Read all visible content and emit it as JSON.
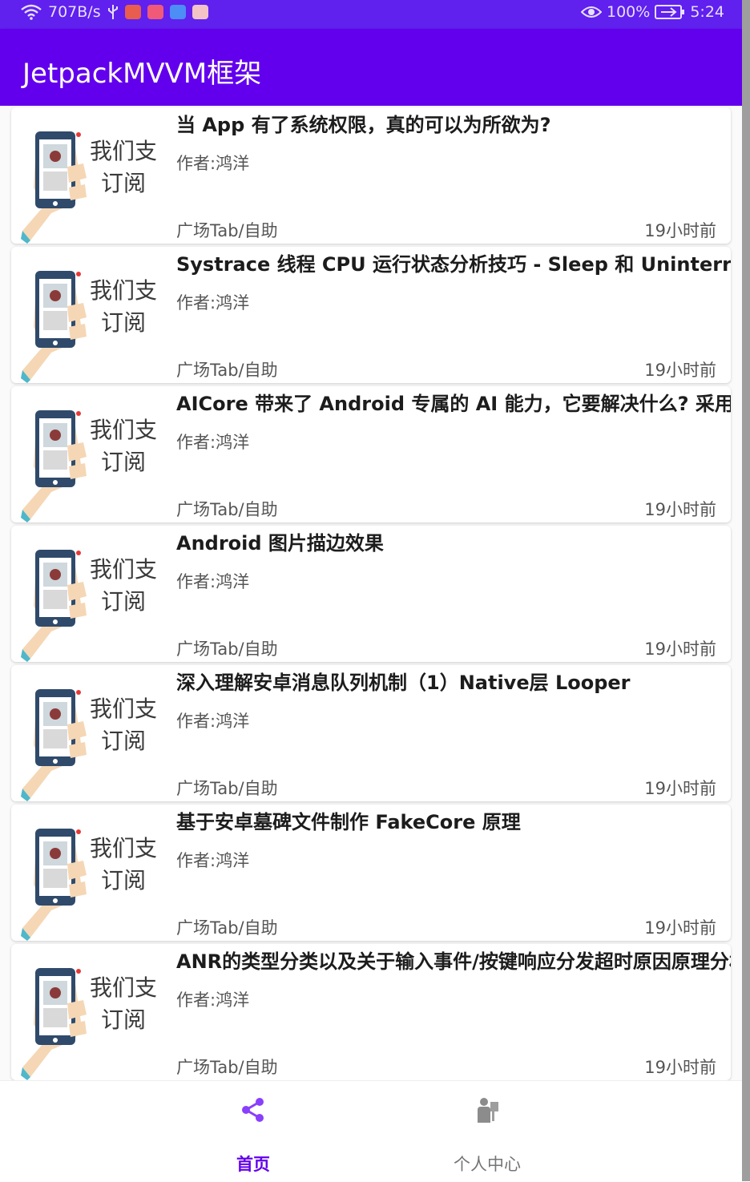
{
  "status_bar": {
    "network_speed": "707B/s",
    "battery": "100%",
    "time": "5:24"
  },
  "app_bar": {
    "title": "JetpackMVVM框架"
  },
  "articles": [
    {
      "title": "当 App 有了系统权限，真的可以为所欲为?",
      "author": "作者:鸿洋",
      "chapter": "广场Tab/自助",
      "time": "19小时前",
      "thumb_text": [
        "我们支",
        "订阅"
      ]
    },
    {
      "title": "Systrace 线程 CPU 运行状态分析技巧 - Sleep 和 Uninterruptible",
      "author": "作者:鸿洋",
      "chapter": "广场Tab/自助",
      "time": "19小时前",
      "thumb_text": [
        "我们支",
        "订阅"
      ]
    },
    {
      "title": "AICore 带来了 Android 专属的 AI 能力，它要解决什么? 采用什么",
      "author": "作者:鸿洋",
      "chapter": "广场Tab/自助",
      "time": "19小时前",
      "thumb_text": [
        "我们支",
        "订阅"
      ]
    },
    {
      "title": "Android 图片描边效果",
      "author": "作者:鸿洋",
      "chapter": "广场Tab/自助",
      "time": "19小时前",
      "thumb_text": [
        "我们支",
        "订阅"
      ]
    },
    {
      "title": "深入理解安卓消息队列机制（1）Native层 Looper",
      "author": "作者:鸿洋",
      "chapter": "广场Tab/自助",
      "time": "19小时前",
      "thumb_text": [
        "我们支",
        "订阅"
      ]
    },
    {
      "title": "基于安卓墓碑文件制作 FakeCore 原理",
      "author": "作者:鸿洋",
      "chapter": "广场Tab/自助",
      "time": "19小时前",
      "thumb_text": [
        "我们支",
        "订阅"
      ]
    },
    {
      "title": "ANR的类型分类以及关于输入事件/按键响应分发超时原因原理分析",
      "author": "作者:鸿洋",
      "chapter": "广场Tab/自助",
      "time": "19小时前",
      "thumb_text": [
        "我们支",
        "订阅"
      ]
    }
  ],
  "bottom_nav": [
    {
      "label": "首页",
      "icon": "share-icon",
      "active": true,
      "color": "#6200ee"
    },
    {
      "label": "个人中心",
      "icon": "person-icon",
      "active": false,
      "color": "#757575"
    }
  ],
  "colors": {
    "primary": "#6200ee",
    "status_bar": "#6020ee"
  }
}
